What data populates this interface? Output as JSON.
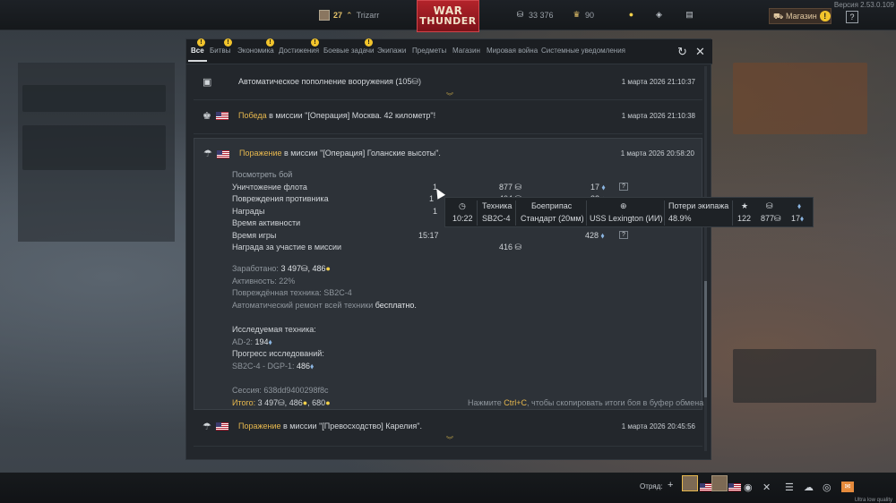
{
  "version": "Версия 2.53.0.109",
  "topbar": {
    "level": "27",
    "username": "Trizarr",
    "silver_lions": "33 376",
    "golden_eagles": "90",
    "shop_label": "Магазин"
  },
  "logo": {
    "line1": "WAR",
    "line2": "THUNDER"
  },
  "tabs": [
    "Все",
    "Битвы",
    "Экономика",
    "Достижения",
    "Боевые задачи",
    "Экипажи",
    "Предметы",
    "Магазин",
    "Мировая война",
    "Системные уведомления"
  ],
  "tabs_with_warning": [
    1,
    2,
    3,
    4,
    5
  ],
  "messages": [
    {
      "text": "Автоматическое пополнение вооружения (105",
      "date": "1 марта 2026 21:10:37"
    },
    {
      "hl": "Победа",
      "text": " в миссии \"[Операция] Москва. 42 километр\"!",
      "date": "1 марта 2026 21:10:38"
    },
    {
      "hl": "Поражение",
      "text": " в миссии \"[Операция] Голанские высоты\".",
      "date": "1 марта 2026 20:58:20"
    },
    {
      "hl": "Поражение",
      "text": " в миссии \"[Превосходство] Карелия\".",
      "date": "1 марта 2026 20:45:56"
    }
  ],
  "battle": {
    "view_battle": "Посмотреть бой",
    "stats": [
      {
        "name": "Уничтожение флота",
        "c1": "1",
        "c2": "877",
        "c3": "17"
      },
      {
        "name": "Повреждения противника",
        "c1": "1",
        "c2": "404",
        "c3": "22"
      },
      {
        "name": "Награды",
        "c1": "1",
        "c2": "",
        "c3": ""
      },
      {
        "name": "Время активности",
        "c1": "",
        "c2": "",
        "c3": ""
      },
      {
        "name": "Время игры",
        "c1": "15:17",
        "c2": "",
        "c3": "428"
      },
      {
        "name": "Награда за участие в миссии",
        "c1": "",
        "c2": "416",
        "c3": ""
      }
    ],
    "earned_label": "Заработано:",
    "earned_sl": "3 497",
    "earned_rp": "486",
    "activity": "Активность: 22%",
    "damaged": "Повреждённая техника: SB2C-4",
    "repair_prefix": "Автоматический ремонт всей техники ",
    "repair_free": "бесплатно.",
    "research_label": "Исследуемая техника:",
    "research_item": "AD-2:",
    "research_val": "194",
    "progress_label": "Прогресс исследований:",
    "progress_item": "SB2C-4 - DGP-1:",
    "progress_val": "486",
    "session": "Сессия: 638dd9400298f8c",
    "total_label": "Итого:",
    "total_sl": "3 497",
    "total_rp": "486",
    "total_ge": "680",
    "copy_hint_prefix": "Нажмите ",
    "copy_hint_key": "Ctrl+C",
    "copy_hint_suffix": ", чтобы скопировать итоги боя в буфер обмена"
  },
  "tooltip": {
    "headers": [
      "Техника",
      "Боеприпас",
      "Потери экипажа"
    ],
    "values": {
      "time": "10:22",
      "vehicle": "SB2C-4",
      "ammo": "Стандарт (20мм)",
      "target": "USS Lexington (ИИ)",
      "crew_loss": "48.9%",
      "score": "122",
      "sl": "877",
      "rp": "17"
    }
  },
  "bottombar": {
    "squad_label": "Отряд:"
  },
  "footer": "Ultra low quality"
}
